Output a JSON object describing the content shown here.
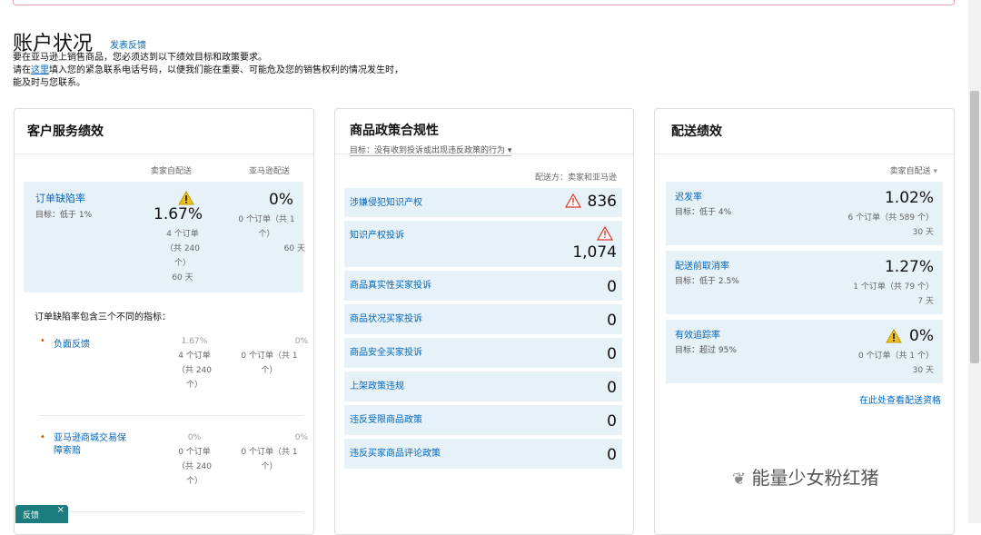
{
  "page": {
    "title": "账户状况",
    "feedback_link": "发表反馈",
    "intro_line1": "要在亚马逊上销售商品，您必须达到以下绩效目标和政策要求。",
    "intro_line2_pre": "请在",
    "intro_link": "这里",
    "intro_line2_post": "填入您的紧急联系电话号码，以便我们能在重要、可能危及您的销售权利的情况发生时，能及时与您联系。"
  },
  "customer_service": {
    "title": "客户服务绩效",
    "col_seller": "卖家自配送",
    "col_amazon": "亚马逊配送",
    "odr": {
      "label": "订单缺陷率",
      "goal": "目标：低于 1%",
      "seller_value": "1.67%",
      "seller_detail1": "4 个订单",
      "seller_detail2": "（共 240",
      "seller_detail3": "个）",
      "seller_days": "60 天",
      "amazon_value": "0%",
      "amazon_detail1": "0 个订单（共 1",
      "amazon_detail2": "个）",
      "amazon_days": "60 天"
    },
    "note": "订单缺陷率包含三个不同的指标：",
    "sub_items": [
      {
        "bullet": "•",
        "label": "负面反馈",
        "seller_value": "1.67%",
        "seller_d1": "4 个订单",
        "seller_d2": "（共 240",
        "seller_d3": "个）",
        "amazon_value": "0%",
        "amazon_d1": "0 个订单（共 1",
        "amazon_d2": "个）"
      },
      {
        "bullet": "•",
        "label1": "亚马逊商城交易保",
        "label2": "障索赔",
        "seller_value": "0%",
        "seller_d1": "0 个订单",
        "seller_d2": "（共 240",
        "seller_d3": "个）",
        "amazon_value": "0%",
        "amazon_d1": "0 个订单（共 1",
        "amazon_d2": "个）"
      }
    ]
  },
  "policy": {
    "title": "商品政策合规性",
    "target_select": "目标：没有收到投诉或出现违反政策的行为",
    "fulfill_label": "配送方：卖家和亚马逊",
    "items": [
      {
        "label": "涉嫌侵犯知识产权",
        "value": "836",
        "warning": true
      },
      {
        "label": "知识产权投诉",
        "value": "1,074",
        "warning": true
      },
      {
        "label": "商品真实性买家投诉",
        "value": "0"
      },
      {
        "label": "商品状况买家投诉",
        "value": "0"
      },
      {
        "label": "商品安全买家投诉",
        "value": "0"
      },
      {
        "label": "上架政策违规",
        "value": "0"
      },
      {
        "label": "违反受限商品政策",
        "value": "0"
      },
      {
        "label": "违反买家商品评论政策",
        "value": "0"
      }
    ]
  },
  "shipping": {
    "title": "配送绩效",
    "selector": "卖家自配送",
    "items": [
      {
        "label": "迟发率",
        "goal": "目标：低于 4%",
        "value": "1.02%",
        "detail": "6 个订单（共 589 个）",
        "days": "30 天"
      },
      {
        "label": "配送前取消率",
        "goal": "目标：低于 2.5%",
        "value": "1.27%",
        "detail": "1 个订单（共 79 个）",
        "days": "7 天"
      },
      {
        "label": "有效追踪率",
        "goal": "目标：超过 95%",
        "value": "0%",
        "detail": "0 个订单（共 1 个）",
        "days": "30 天",
        "warning": true
      }
    ],
    "link": "在此处查看配送资格"
  },
  "feedback_button": {
    "label": "反馈",
    "close": "×"
  },
  "watermark": "能量少女粉红猪",
  "colors": {
    "link": "#0066c0",
    "row_bg": "#e6f1f8",
    "warning_yellow": "#f0c020",
    "warning_red": "#d9382e"
  }
}
